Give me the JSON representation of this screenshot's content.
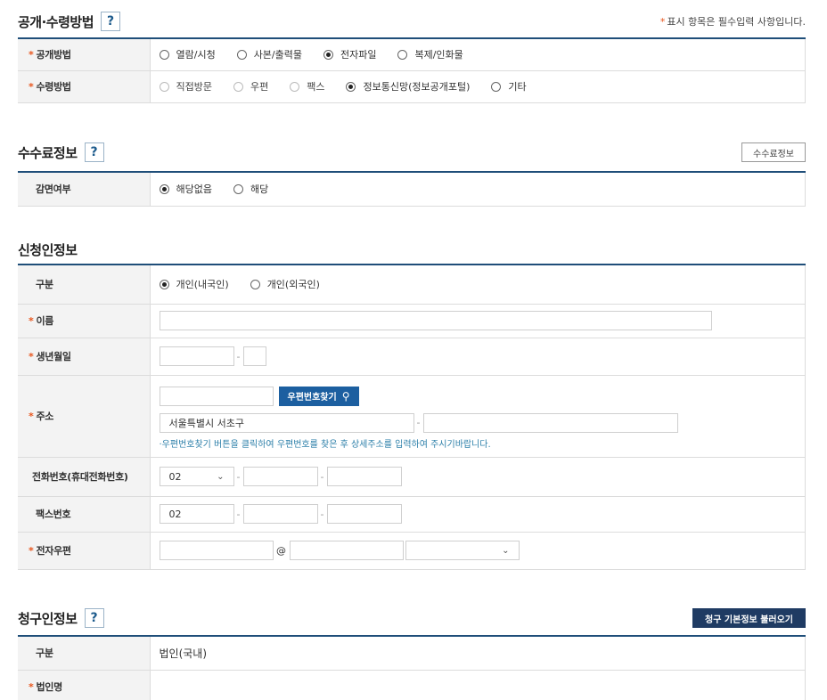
{
  "disclosure": {
    "title": "공개·수령방법",
    "help": "?",
    "required_note": "표시 항목은 필수입력 사항입니다.",
    "required_mark": "*",
    "method_label": "공개방법",
    "method_options": [
      "열람/시청",
      "사본/출력물",
      "전자파일",
      "복제/인화물"
    ],
    "method_selected": "전자파일",
    "receive_label": "수령방법",
    "receive_options": [
      "직접방문",
      "우편",
      "팩스",
      "정보통신망(정보공개포털)",
      "기타"
    ],
    "receive_selected": "정보통신망(정보공개포털)"
  },
  "fee": {
    "title": "수수료정보",
    "help": "?",
    "info_button": "수수료정보",
    "exempt_label": "감면여부",
    "exempt_options": [
      "해당없음",
      "해당"
    ],
    "exempt_selected": "해당없음"
  },
  "applicant": {
    "title": "신청인정보",
    "type_label": "구분",
    "type_options": [
      "개인(내국인)",
      "개인(외국인)"
    ],
    "type_selected": "개인(내국인)",
    "name_label": "이름",
    "name_value": "",
    "birth_label": "생년월일",
    "birth_value_1": "",
    "birth_value_2": "",
    "address_label": "주소",
    "zip_value": "",
    "zip_button": "우편번호찾기",
    "address_value": "서울특별시 서초구",
    "address_detail": "",
    "address_hint": "·우편번호찾기 버튼을 클릭하여 우편번호를 찾은 후 상세주소를 입력하여 주시기바랍니다.",
    "phone_label": "전화번호(휴대전화번호)",
    "phone_area": "02",
    "phone_mid": "",
    "phone_last": "",
    "fax_label": "팩스번호",
    "fax_area": "02",
    "fax_mid": "",
    "fax_last": "",
    "email_label": "전자우편",
    "email_id": "",
    "email_at": "@",
    "email_domain": "",
    "email_select": ""
  },
  "claimant": {
    "title": "청구인정보",
    "help": "?",
    "load_button": "청구 기본정보 불러오기",
    "type_label": "구분",
    "type_value": "법인(국내)",
    "corp_name_label": "법인명",
    "corp_name_value": ""
  },
  "colors": {
    "header_line": "#1f4e79",
    "required_star": "#e8551c",
    "zip_button": "#1c5fa0",
    "load_button": "#1f3b63",
    "hint_text": "#2c7fa9"
  }
}
